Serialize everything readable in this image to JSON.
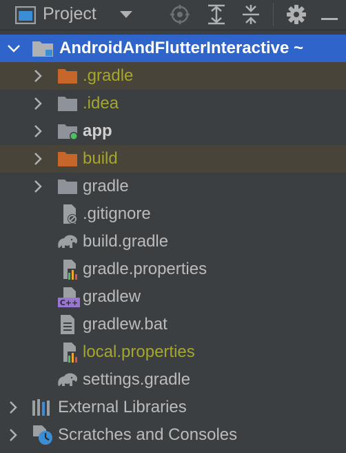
{
  "header": {
    "title": "Project",
    "icons": [
      "project-view-icon",
      "dropdown-chevron-icon",
      "locate-target-icon",
      "expand-all-icon",
      "collapse-all-icon",
      "gear-icon",
      "hide-minus-icon"
    ]
  },
  "tree": {
    "root_label": "AndroidAndFlutterInteractive ~",
    "items": [
      {
        "label": ".gradle"
      },
      {
        "label": ".idea"
      },
      {
        "label": "app"
      },
      {
        "label": "build"
      },
      {
        "label": "gradle"
      },
      {
        "label": ".gitignore"
      },
      {
        "label": "build.gradle"
      },
      {
        "label": "gradle.properties"
      },
      {
        "label": "gradlew"
      },
      {
        "label": "gradlew.bat"
      },
      {
        "label": "local.properties"
      },
      {
        "label": "settings.gradle"
      }
    ],
    "external_libraries": "External Libraries",
    "scratches": "Scratches and Consoles"
  },
  "colors": {
    "background": "#3c3f41",
    "selection": "#2f65ca",
    "excluded_row": "#49443a",
    "olive_text": "#a6a62c",
    "folder_orange": "#c7662a",
    "folder_gray": "#8e9399"
  }
}
